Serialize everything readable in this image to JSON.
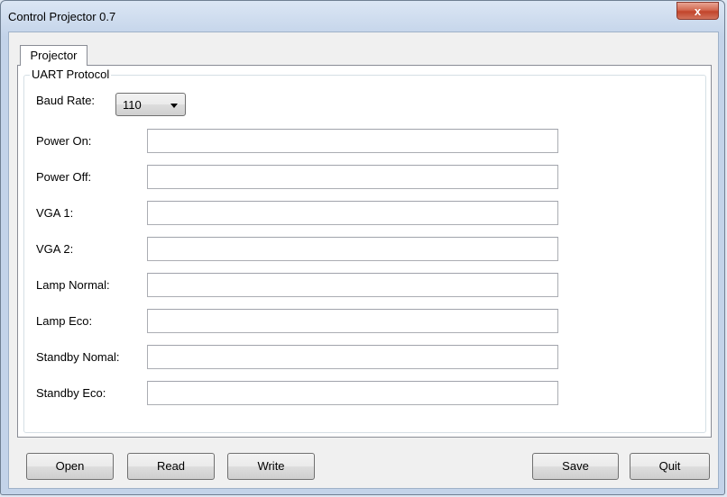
{
  "window": {
    "title": "Control Projector 0.7",
    "close_label": "x"
  },
  "tabs": [
    {
      "label": "Projector"
    }
  ],
  "group": {
    "title": "UART Protocol",
    "baud_label": "Baud Rate:",
    "baud_value": "110"
  },
  "fields": [
    {
      "label": "Power On:",
      "value": ""
    },
    {
      "label": "Power Off:",
      "value": ""
    },
    {
      "label": "VGA 1:",
      "value": ""
    },
    {
      "label": "VGA 2:",
      "value": ""
    },
    {
      "label": "Lamp Normal:",
      "value": ""
    },
    {
      "label": "Lamp Eco:",
      "value": ""
    },
    {
      "label": "Standby Nomal:",
      "value": ""
    },
    {
      "label": "Standby Eco:",
      "value": ""
    }
  ],
  "buttons": {
    "open": "Open",
    "read": "Read",
    "write": "Write",
    "save": "Save",
    "quit": "Quit"
  }
}
